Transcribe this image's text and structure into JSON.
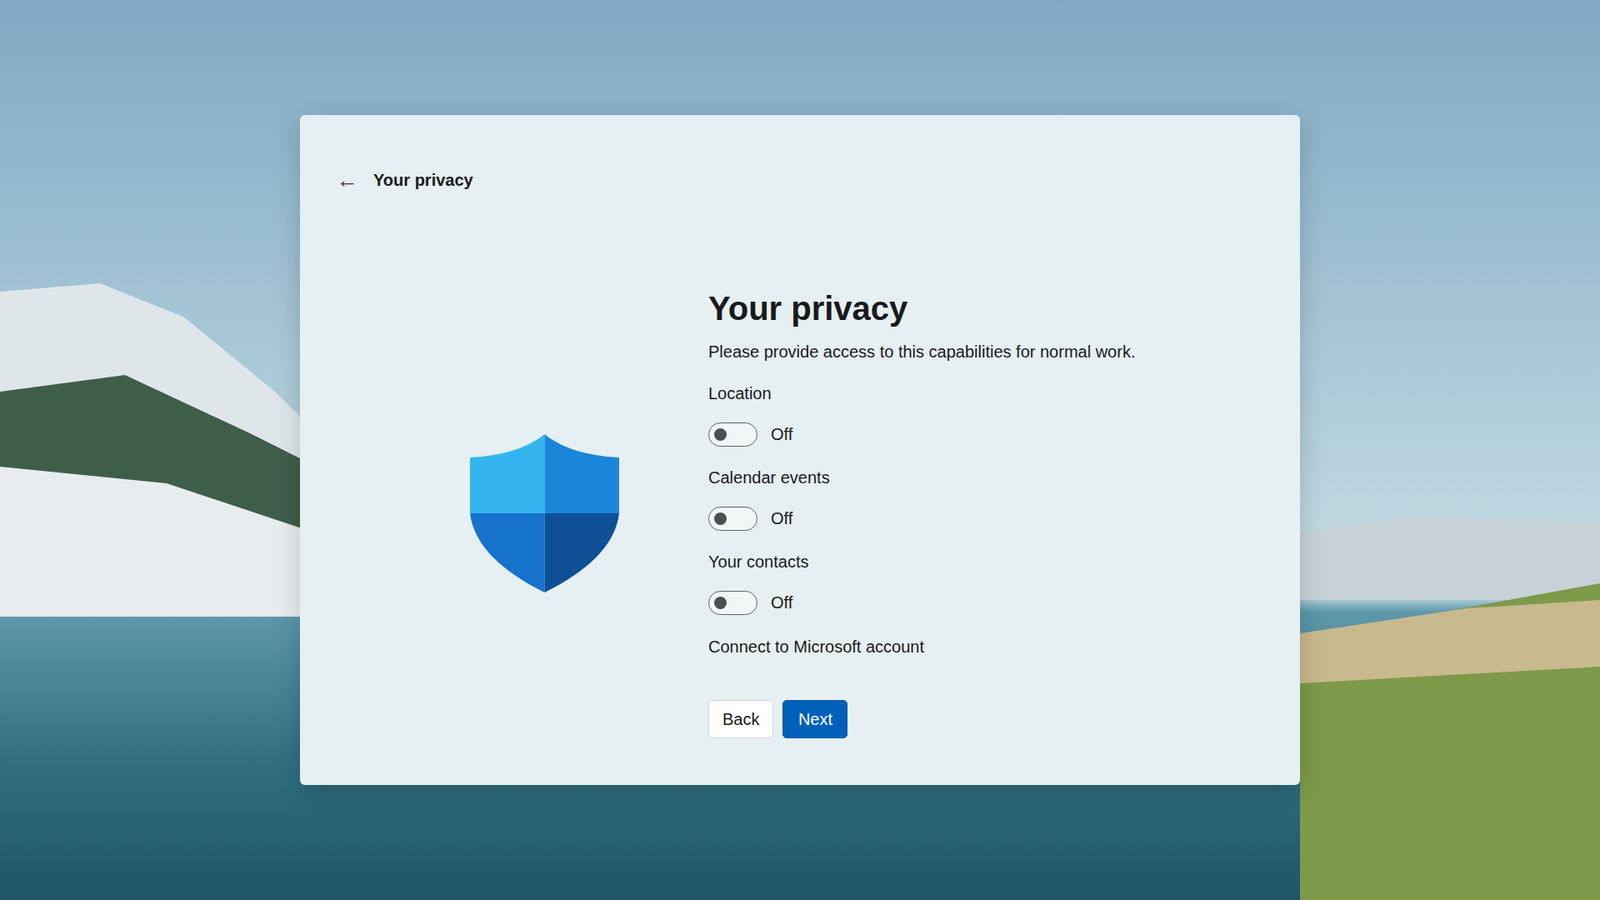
{
  "header": {
    "back_icon": "←",
    "title": "Your privacy"
  },
  "heading": "Your privacy",
  "description": "Please provide access to this capabilities for normal work.",
  "settings": [
    {
      "label": "Location",
      "on": false,
      "state": "Off"
    },
    {
      "label": "Calendar events",
      "on": false,
      "state": "Off"
    },
    {
      "label": "Your contacts",
      "on": false,
      "state": "Off"
    }
  ],
  "link": "Connect to Microsoft account",
  "buttons": [
    {
      "label": "Back",
      "primary": false
    },
    {
      "label": "Next",
      "primary": true
    }
  ]
}
